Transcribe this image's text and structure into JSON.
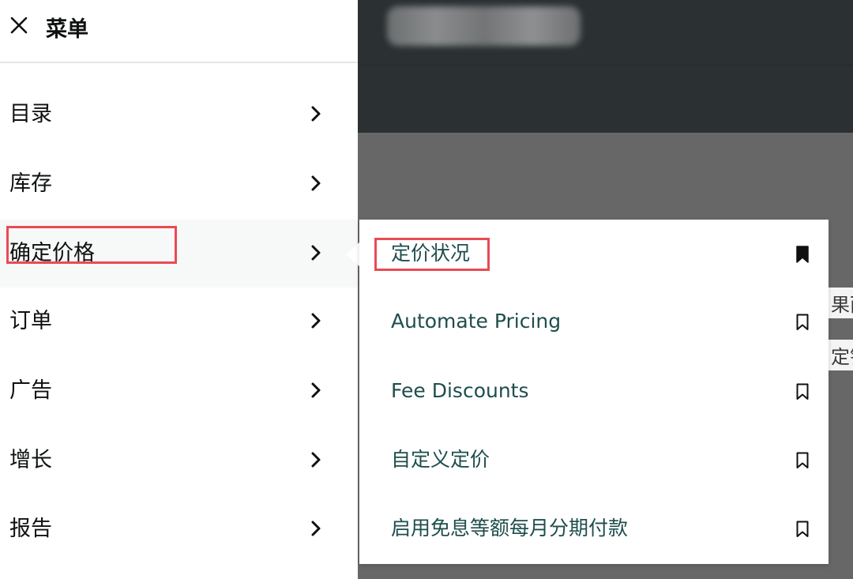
{
  "header": {
    "close_icon": "close-icon",
    "title": "菜单"
  },
  "menu": {
    "items": [
      {
        "label": "目录",
        "icon": "chevron-right-icon"
      },
      {
        "label": "库存",
        "icon": "chevron-right-icon"
      },
      {
        "label": "确定价格",
        "icon": "chevron-right-icon",
        "active": true
      },
      {
        "label": "订单",
        "icon": "chevron-right-icon"
      },
      {
        "label": "广告",
        "icon": "chevron-right-icon"
      },
      {
        "label": "增长",
        "icon": "chevron-right-icon"
      },
      {
        "label": "报告",
        "icon": "chevron-right-icon"
      }
    ]
  },
  "submenu": {
    "items": [
      {
        "label": "定价状况",
        "bookmarked": true
      },
      {
        "label": "Automate Pricing",
        "bookmarked": false
      },
      {
        "label": "Fee Discounts",
        "bookmarked": false
      },
      {
        "label": "自定义定价",
        "bookmarked": false
      },
      {
        "label": "启用免息等额每月分期付款",
        "bookmarked": false
      }
    ]
  },
  "background": {
    "fragment_1": "果而",
    "fragment_2": "定锗"
  },
  "colors": {
    "text_primary": "#0f1111",
    "submenu_text": "#1f4d4d",
    "highlight_border": "#ea4a55",
    "topbar": "#2b3133",
    "overlay": "#666666"
  }
}
